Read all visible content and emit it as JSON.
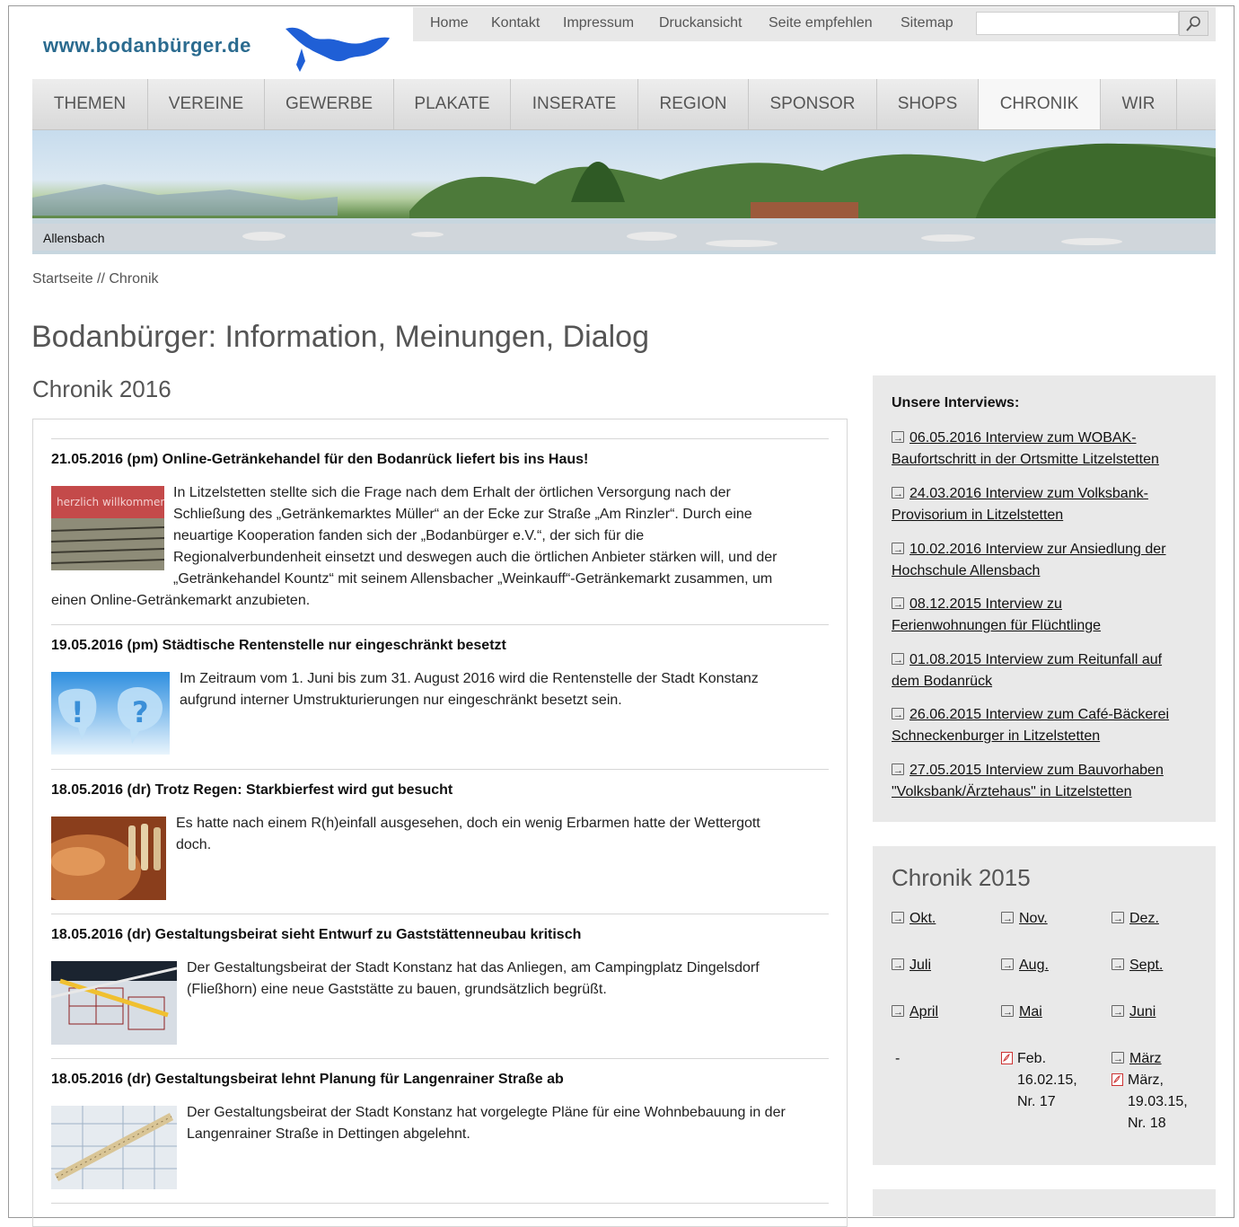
{
  "header": {
    "logo_text": "www.bodanbürger.de",
    "top_nav": [
      "Home",
      "Kontakt",
      "Impressum",
      "Druckansicht",
      "Seite empfehlen",
      "Sitemap"
    ],
    "search": {
      "value": "",
      "placeholder": ""
    }
  },
  "main_nav": [
    "THEMEN",
    "VEREINE",
    "GEWERBE",
    "PLAKATE",
    "INSERATE",
    "REGION",
    "SPONSOR",
    "SHOPS",
    "CHRONIK",
    "WIR"
  ],
  "main_nav_active": "CHRONIK",
  "banner": {
    "caption": "Allensbach"
  },
  "breadcrumb": "Startseite // Chronik",
  "page_title": "Bodanbürger: Information, Meinungen, Dialog",
  "section_title": "Chronik 2016",
  "news": [
    {
      "headline": "21.05.2016 (pm) Online-Getränkehandel für den Bodanrück liefert bis ins Haus!",
      "thumb_text": "herzlich willkommen!",
      "text_lines": [
        "In Litzelstetten stellte sich die Frage nach dem Erhalt der örtlichen Versorgung nach der",
        "Schließung des „Getränkemarktes Müller“ an der Ecke zur Straße „Am Rinzler“. Durch eine",
        "neuartige Kooperation fanden sich der „Bodanbürger e.V.“, der sich für die",
        "Regionalverbundenheit einsetzt und deswegen auch die örtlichen Anbieter stärken will, und der",
        "„Getränkehandel Kountz“ mit seinem Allensbacher „Weinkauff“-Getränkemarkt zusammen, um",
        "einen Online-Getränkemarkt anzubieten."
      ]
    },
    {
      "headline": "19.05.2016 (pm) Städtische Rentenstelle nur eingeschränkt besetzt",
      "thumb_text": "!?",
      "text_lines": [
        "Im Zeitraum vom 1. Juni bis zum 31. August 2016 wird die Rentenstelle der Stadt Konstanz",
        "aufgrund interner Umstrukturierungen nur eingeschränkt besetzt sein."
      ]
    },
    {
      "headline": "18.05.2016 (dr) Trotz Regen: Starkbierfest wird gut besucht",
      "text_lines": [
        "Es hatte nach einem R(h)einfall ausgesehen, doch ein wenig Erbarmen hatte der Wettergott",
        "doch."
      ]
    },
    {
      "headline": "18.05.2016 (dr) Gestaltungsbeirat sieht Entwurf zu Gaststättenneubau kritisch",
      "text_lines": [
        "Der Gestaltungsbeirat der Stadt Konstanz hat das Anliegen, am Campingplatz Dingelsdorf",
        "(Fließhorn) eine neue Gaststätte zu bauen, grundsätzlich begrüßt."
      ]
    },
    {
      "headline": "18.05.2016 (dr) Gestaltungsbeirat lehnt Planung für Langenrainer Straße ab",
      "text_lines": [
        "Der Gestaltungsbeirat der Stadt Konstanz hat vorgelegte Pläne für eine Wohnbebauung in der",
        "Langenrainer Straße in Dettingen abgelehnt."
      ]
    }
  ],
  "interviews": {
    "heading": "Unsere Interviews:",
    "items": [
      [
        "06.05.2016 Interview zum WOBAK-",
        "Baufortschritt in der Ortsmitte Litzelstetten"
      ],
      [
        "24.03.2016 Interview zum Volksbank-",
        "Provisorium in Litzelstetten"
      ],
      [
        "10.02.2016 Interview zur Ansiedlung der",
        "Hochschule Allensbach"
      ],
      [
        "08.12.2015 Interview zu",
        "Ferienwohnungen für Flüchtlinge"
      ],
      [
        "01.08.2015 Interview zum Reitunfall auf",
        "dem Bodanrück"
      ],
      [
        "26.06.2015 Interview zum Café-Bäckerei",
        "Schneckenburger in Litzelstetten"
      ],
      [
        "27.05.2015 Interview zum Bauvorhaben",
        "\"Volksbank/Ärztehaus\" in Litzelstetten"
      ]
    ]
  },
  "chronik2015": {
    "title": "Chronik 2015",
    "rows": [
      [
        "Okt.",
        "Nov.",
        "Dez."
      ],
      [
        "Juli",
        "Aug.",
        "Sept."
      ],
      [
        "April",
        "Mai",
        "Juni"
      ]
    ],
    "last_row": {
      "col1": "-",
      "col2_lines": [
        "Feb.",
        "16.02.15,",
        "Nr. 17"
      ],
      "col3_first": "März",
      "col3_lines": [
        "März,",
        "19.03.15,",
        "Nr. 18"
      ]
    }
  },
  "colors": {
    "logo": "#2b6b8f",
    "nav_bg": "#e0e0e0",
    "sidebar_bg": "#e9e9e9"
  }
}
